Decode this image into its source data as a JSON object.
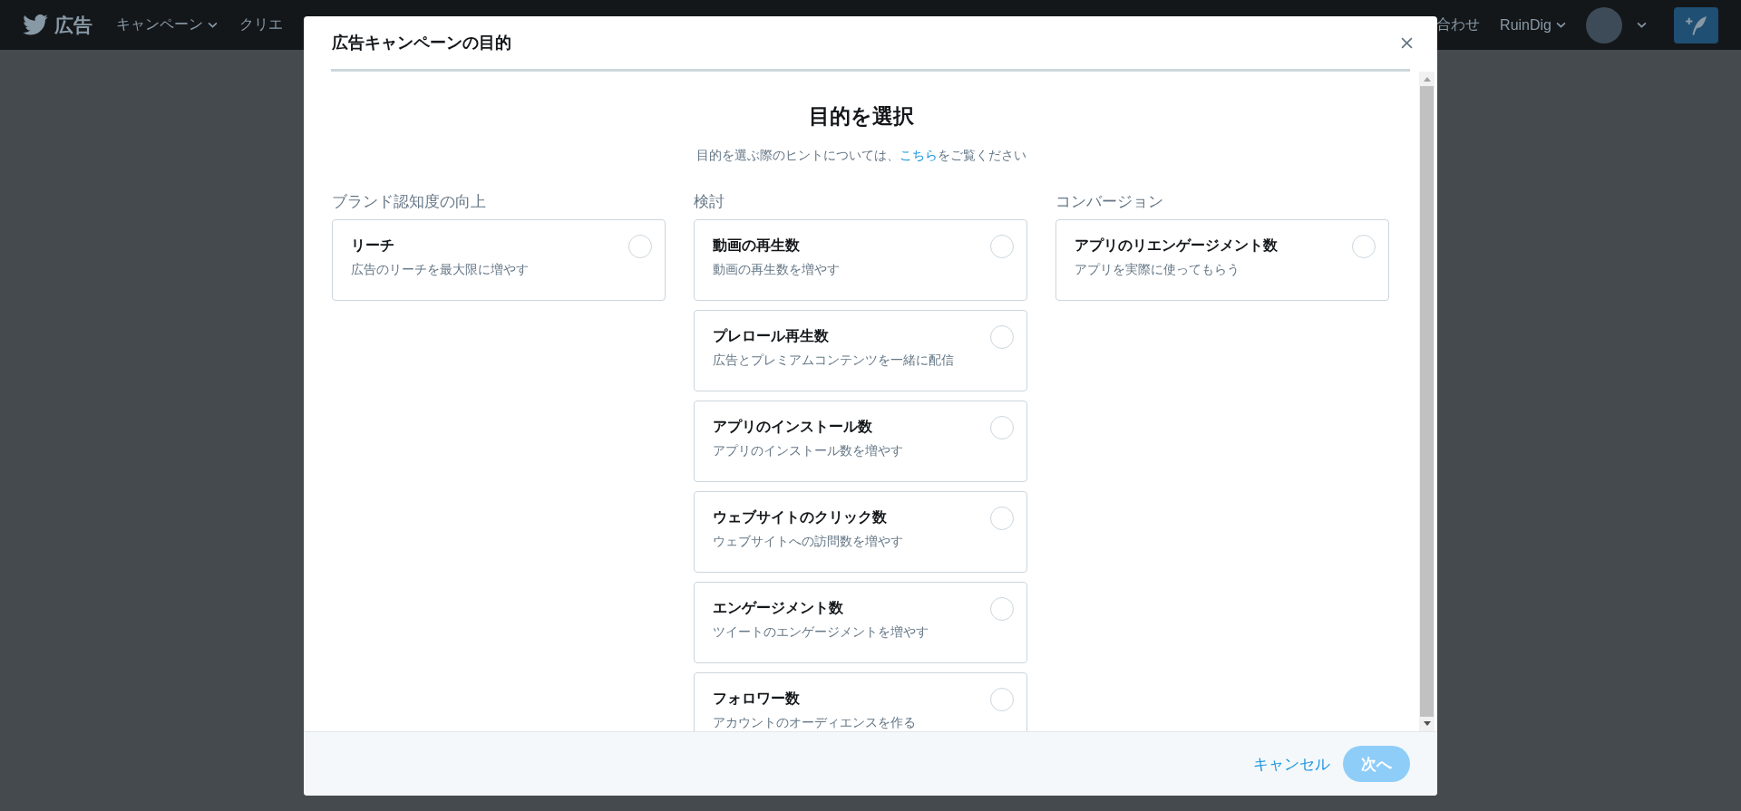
{
  "top_bar": {
    "brand": "広告",
    "nav": [
      {
        "label": "キャンペーン",
        "dropdown": true
      },
      {
        "label": "クリエ",
        "dropdown": false
      }
    ],
    "right_link": "合わせ",
    "account": "RuinDig"
  },
  "modal": {
    "title": "広告キャンペーンの目的",
    "heading": "目的を選択",
    "hint_before": "目的を選ぶ際のヒントについては、",
    "hint_link": "こちら",
    "hint_after": "をご覧ください",
    "columns": [
      {
        "title": "ブランド認知度の向上",
        "objectives": [
          {
            "name": "リーチ",
            "description": "広告のリーチを最大限に増やす",
            "selected": false
          }
        ]
      },
      {
        "title": "検討",
        "objectives": [
          {
            "name": "動画の再生数",
            "description": "動画の再生数を増やす",
            "selected": false
          },
          {
            "name": "プレロール再生数",
            "description": "広告とプレミアムコンテンツを一緒に配信",
            "selected": false
          },
          {
            "name": "アプリのインストール数",
            "description": "アプリのインストール数を増やす",
            "selected": false
          },
          {
            "name": "ウェブサイトのクリック数",
            "description": "ウェブサイトへの訪問数を増やす",
            "selected": false
          },
          {
            "name": "エンゲージメント数",
            "description": "ツイートのエンゲージメントを増やす",
            "selected": false
          },
          {
            "name": "フォロワー数",
            "description": "アカウントのオーディエンスを作る",
            "selected": false
          }
        ]
      },
      {
        "title": "コンバージョン",
        "objectives": [
          {
            "name": "アプリのリエンゲージメント数",
            "description": "アプリを実際に使ってもらう",
            "selected": false
          }
        ]
      }
    ],
    "cancel": "キャンセル",
    "next": {
      "label": "次へ",
      "disabled": true
    }
  }
}
